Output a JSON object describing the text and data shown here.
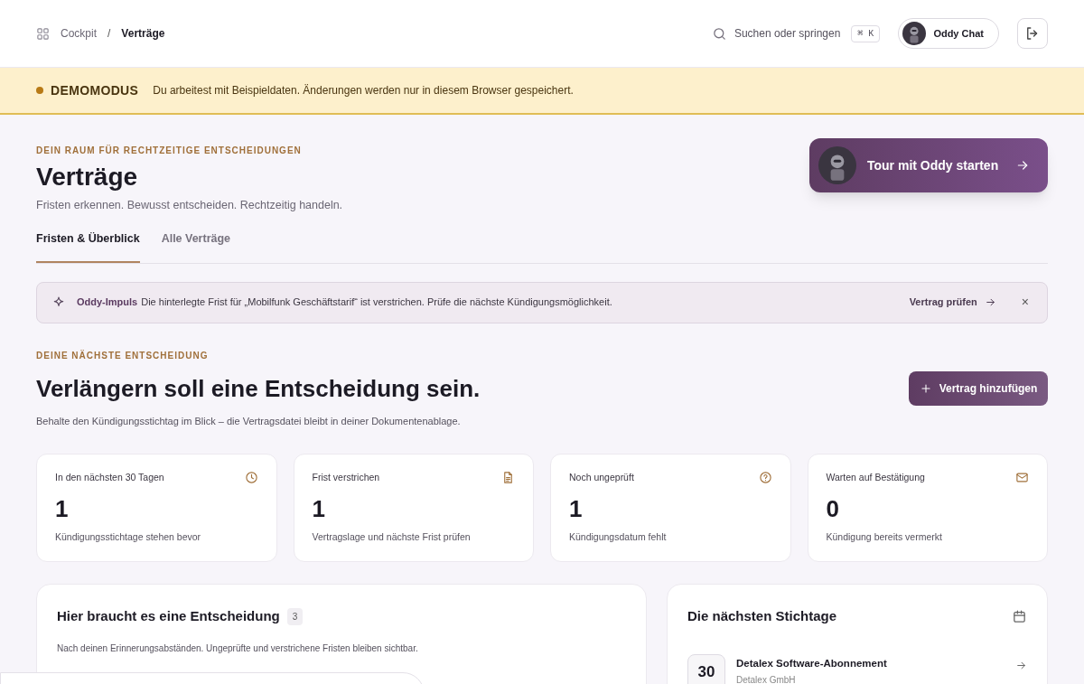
{
  "breadcrumb": [
    {
      "label": "Cockpit",
      "current": false
    },
    {
      "label": "Verträge",
      "current": true
    }
  ],
  "breadcrumb_separator": "/",
  "search": {
    "placeholder": "Suchen oder springen",
    "shortcut": "⌘ K"
  },
  "chat_button": {
    "label": "Oddy Chat"
  },
  "demo_banner": {
    "title": "DEMOMODUS",
    "text": "Du arbeitest mit Beispieldaten. Änderungen werden nur in diesem Browser gespeichert."
  },
  "header": {
    "eyebrow": "DEIN RAUM FÜR RECHTZEITIGE ENTSCHEIDUNGEN",
    "title": "Verträge",
    "subtitle": "Fristen erkennen. Bewusst entscheiden. Rechtzeitig handeln."
  },
  "tour_button": {
    "label": "Tour mit Oddy starten"
  },
  "tabs": [
    {
      "label": "Fristen & Überblick",
      "selected": true
    },
    {
      "label": "Alle Verträge",
      "selected": false
    }
  ],
  "impulse": {
    "label": "Oddy-Impuls",
    "text": "Die hinterlegte Frist für „Mobilfunk Geschäftstarif“ ist verstrichen. Prüfe die nächste Kündigungsmöglichkeit.",
    "action": "Vertrag prüfen",
    "close": "×"
  },
  "decision": {
    "eyebrow": "DEINE NÄCHSTE ENTSCHEIDUNG",
    "title": "Verlängern soll eine Entscheidung sein.",
    "text": "Behalte den Kündigungsstichtag im Blick – die Vertragsdatei bleibt in deiner Dokumentenablage.",
    "add_button": "Vertrag hinzufügen"
  },
  "stats": [
    {
      "kind": "clock",
      "label": "In den nächsten 30 Tagen",
      "value": "1",
      "caption": "Kündigungsstichtage stehen bevor"
    },
    {
      "kind": "document",
      "label": "Frist verstrichen",
      "value": "1",
      "caption": "Vertragslage und nächste Frist prüfen"
    },
    {
      "kind": "question",
      "label": "Noch ungeprüft",
      "value": "1",
      "caption": "Kündigungsdatum fehlt"
    },
    {
      "kind": "mail",
      "label": "Warten auf Bestätigung",
      "value": "0",
      "caption": "Kündigung bereits vermerkt"
    }
  ],
  "decisions_panel": {
    "title": "Hier braucht es eine Entscheidung",
    "count": "3",
    "text": "Nach deinen Erinnerungsabständen. Ungeprüfte und verstrichene Fristen bleiben sichtbar."
  },
  "deadlines_panel": {
    "title": "Die nächsten Stichtage",
    "items": [
      {
        "day": "30",
        "name": "Detalex Software-Abonnement",
        "company": "Detalex GmbH"
      }
    ]
  }
}
